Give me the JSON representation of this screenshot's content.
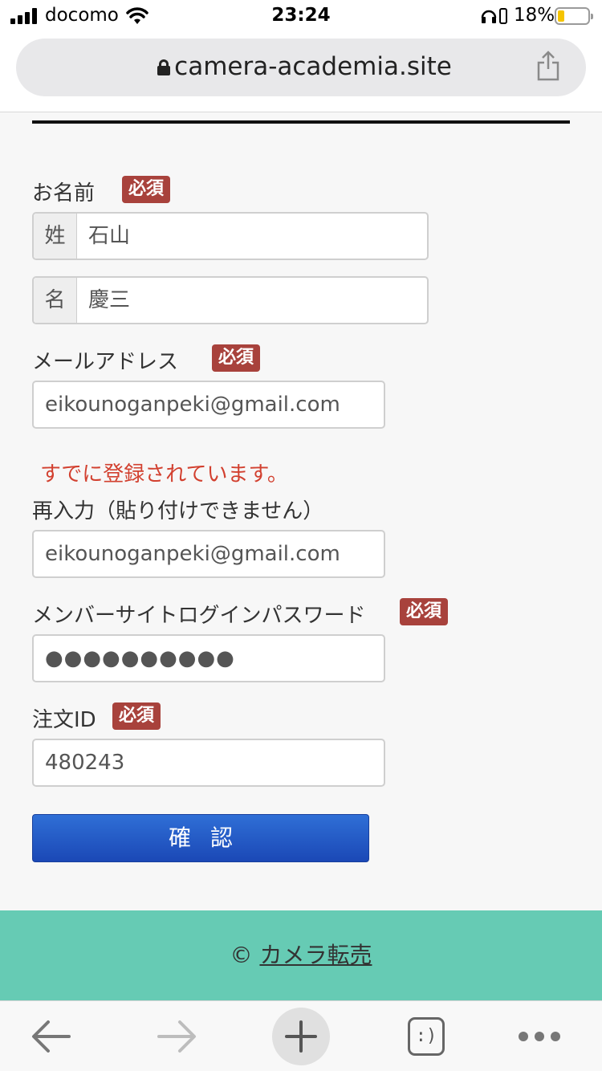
{
  "status_bar": {
    "carrier": "docomo",
    "time": "23:24",
    "battery_percent": "18%",
    "battery_level": 0.18
  },
  "browser": {
    "url": "camera-academia.site"
  },
  "form": {
    "name": {
      "label": "お名前",
      "required": "必須",
      "last_prefix": "姓",
      "last_value": "石山",
      "first_prefix": "名",
      "first_value": "慶三"
    },
    "email": {
      "label": "メールアドレス",
      "required": "必須",
      "value": "eikounoganpeki@gmail.com",
      "error": "すでに登録されています。"
    },
    "email_confirm": {
      "label": "再入力（貼り付けできません）",
      "value": "eikounoganpeki@gmail.com"
    },
    "password": {
      "label": "メンバーサイトログインパスワード",
      "required": "必須",
      "masked_value": "●●●●●●●●●●"
    },
    "order_id": {
      "label": "注文ID",
      "required": "必須",
      "value": "480243"
    },
    "submit_label": "確認"
  },
  "footer": {
    "copyright_symbol": "©",
    "link_text": "カメラ転売"
  },
  "toolbar": {
    "tabs_icon_text": ":)"
  },
  "colors": {
    "badge": "#a8423c",
    "error": "#d2402f",
    "button": "#1b48b6",
    "footer": "#66cbb4"
  }
}
